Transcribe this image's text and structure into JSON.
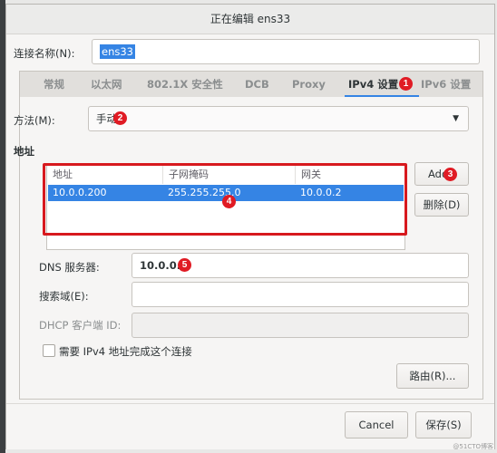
{
  "window": {
    "title": "正在编辑 ens33"
  },
  "connection_name": {
    "label": "连接名称(N):",
    "value": "ens33"
  },
  "tabs": [
    {
      "label": "常规"
    },
    {
      "label": "以太网"
    },
    {
      "label": "802.1X 安全性"
    },
    {
      "label": "DCB"
    },
    {
      "label": "Proxy"
    },
    {
      "label": "IPv4 设置",
      "active": true
    },
    {
      "label": "IPv6 设置"
    }
  ],
  "method": {
    "label": "方法(M):",
    "value": "手动"
  },
  "address_section": {
    "heading": "地址",
    "columns": [
      "地址",
      "子网掩码",
      "网关"
    ],
    "rows": [
      {
        "address": "10.0.0.200",
        "netmask": "255.255.255.0",
        "gateway": "10.0.0.2"
      }
    ],
    "add_button": "Add",
    "delete_button": "删除(D)"
  },
  "dns": {
    "label": "DNS 服务器:",
    "value": "10.0.0.2"
  },
  "search_domains": {
    "label": "搜索域(E):",
    "value": ""
  },
  "dhcp_client_id": {
    "label": "DHCP 客户端 ID:",
    "value": ""
  },
  "require_ipv4": {
    "label": "需要 IPv4 地址完成这个连接",
    "checked": false
  },
  "routes_button": "路由(R)...",
  "footer": {
    "cancel": "Cancel",
    "save": "保存(S)"
  },
  "annotations": [
    "1",
    "2",
    "3",
    "4",
    "5"
  ],
  "colors": {
    "accent": "#3584e4",
    "annotation_red": "#e01b24"
  },
  "watermark": "@51CTO博客"
}
